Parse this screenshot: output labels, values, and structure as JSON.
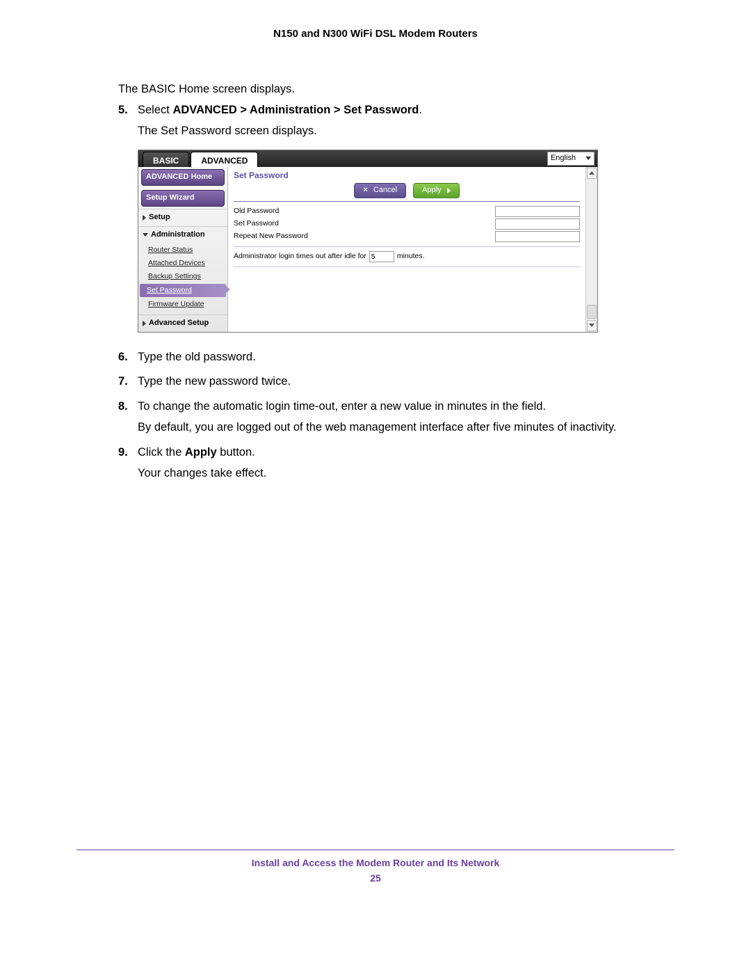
{
  "header": "N150 and N300 WiFi DSL Modem Routers",
  "pre_text": "The BASIC Home screen displays.",
  "steps": {
    "s5": {
      "num": "5.",
      "prefix": "Select ",
      "bold": "ADVANCED > Administration > Set Password",
      "suffix": ".",
      "after": "The Set Password screen displays."
    },
    "s6": {
      "num": "6.",
      "text": "Type the old password."
    },
    "s7": {
      "num": "7.",
      "text": "Type the new password twice."
    },
    "s8": {
      "num": "8.",
      "text": "To change the automatic login time-out, enter a new value in minutes in the field.",
      "after": "By default, you are logged out of the web management interface after five minutes of inactivity."
    },
    "s9": {
      "num": "9.",
      "prefix": "Click the ",
      "bold": "Apply",
      "suffix": " button.",
      "after": "Your changes take effect."
    }
  },
  "ui": {
    "tabs": {
      "basic": "BASIC",
      "advanced": "ADVANCED"
    },
    "language": "English",
    "sidebar": {
      "home": "ADVANCED Home",
      "wizard": "Setup Wizard",
      "setup": "Setup",
      "admin": "Administration",
      "subs": {
        "status": "Router Status",
        "attached": "Attached Devices",
        "backup": "Backup Settings",
        "setpwd": "Set Password",
        "firmware": "Firmware Update"
      },
      "adv_setup": "Advanced Setup"
    },
    "main": {
      "title": "Set Password",
      "cancel": "Cancel",
      "apply": "Apply",
      "old_pw": "Old Password",
      "set_pw": "Set Password",
      "repeat_pw": "Repeat New Password",
      "idle_pre": "Administrator login times out after idle for",
      "idle_val": "5",
      "idle_post": "minutes."
    }
  },
  "footer": {
    "text": "Install and Access the Modem Router and Its Network",
    "page": "25"
  }
}
